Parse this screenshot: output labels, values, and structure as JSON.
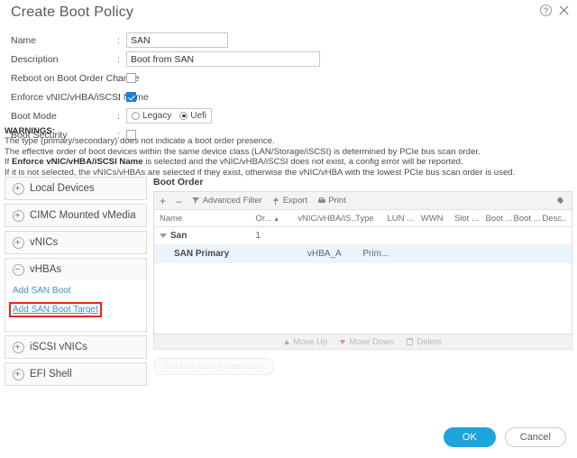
{
  "header": {
    "title": "Create Boot Policy",
    "help_icon": "help-icon",
    "close_icon": "close-icon"
  },
  "form": {
    "name": {
      "label": "Name",
      "value": "SAN"
    },
    "description": {
      "label": "Description",
      "value": "Boot from SAN"
    },
    "reboot_on_boot_order_change": {
      "label": "Reboot on Boot Order Change",
      "checked": false
    },
    "enforce_name": {
      "label": "Enforce vNIC/vHBA/iSCSI Name",
      "checked": true
    },
    "boot_mode": {
      "label": "Boot Mode",
      "options": [
        "Legacy",
        "Uefi"
      ],
      "selected": "Uefi"
    },
    "boot_security": {
      "label": "Boot Security",
      "checked": false
    },
    "colon": ":"
  },
  "warnings": {
    "title": "WARNINGS:",
    "line1": "The type (primary/secondary) does not indicate a boot order presence.",
    "line2": "The effective order of boot devices within the same device class (LAN/Storage/iSCSI) is determined by PCIe bus scan order.",
    "line3_prefix": "If ",
    "line3_bold": "Enforce vNIC/vHBA/iSCSI Name",
    "line3_suffix": " is selected and the vNIC/vHBA/iSCSI does not exist, a config error will be reported.",
    "line4": "If it is not selected, the vNICs/vHBAs are selected if they exist, otherwise the vNIC/vHBA with the lowest PCIe bus scan order is used."
  },
  "accordion": {
    "items": [
      {
        "label": "Local Devices",
        "expanded": false
      },
      {
        "label": "CIMC Mounted vMedia",
        "expanded": false
      },
      {
        "label": "vNICs",
        "expanded": false
      },
      {
        "label": "vHBAs",
        "expanded": true
      },
      {
        "label": "iSCSI vNICs",
        "expanded": false
      },
      {
        "label": "EFI Shell",
        "expanded": false
      }
    ],
    "vhba_links": [
      {
        "label": "Add SAN Boot",
        "highlighted": false
      },
      {
        "label": "Add SAN Boot Target",
        "highlighted": true
      }
    ],
    "highlight_color": "#e8241a"
  },
  "boot_order": {
    "title": "Boot Order",
    "toolbar": {
      "add_label": "+",
      "remove_label": "–",
      "advanced_filter_label": "Advanced Filter",
      "export_label": "Export",
      "print_label": "Print",
      "settings_icon": "gear-icon"
    },
    "columns": [
      "Name",
      "Or...",
      "vNIC/vHBA/iS...",
      "Type",
      "LUN ...",
      "WWN",
      "Slot ...",
      "Boot ...",
      "Boot ...",
      "Desc..."
    ],
    "sort_column": "Or...",
    "sort_direction": "ascending",
    "rows": [
      {
        "name": "San",
        "order": "1",
        "vnic": "",
        "type": "",
        "lun": "",
        "wwn": "",
        "slot": "",
        "boot1": "",
        "boot2": "",
        "desc": "",
        "group": true,
        "expanded": true,
        "selected": false
      },
      {
        "name": "SAN Primary",
        "order": "",
        "vnic": "vHBA_A",
        "type": "Prim...",
        "lun": "",
        "wwn": "",
        "slot": "",
        "boot1": "",
        "boot2": "",
        "desc": "",
        "group": false,
        "expanded": false,
        "selected": true
      }
    ],
    "actions": {
      "move_up": "Move Up",
      "move_down": "Move Down",
      "delete": "Delete"
    },
    "uefi_button": "Set Uefi Boot Parameters"
  },
  "footer": {
    "ok": "OK",
    "cancel": "Cancel",
    "ok_color": "#1ca4db"
  }
}
